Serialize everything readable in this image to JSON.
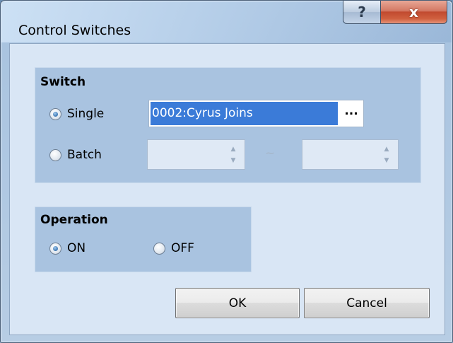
{
  "window": {
    "title": "Control Switches",
    "help_glyph": "?",
    "close_glyph": "x"
  },
  "switch_group": {
    "title": "Switch",
    "single_label": "Single",
    "batch_label": "Batch",
    "single_value": "0002:Cyrus Joins",
    "browse_label": "...",
    "range_separator": "~",
    "batch_from": "",
    "batch_to": "",
    "selected": "Single"
  },
  "operation_group": {
    "title": "Operation",
    "on_label": "ON",
    "off_label": "OFF",
    "selected": "ON"
  },
  "buttons": {
    "ok_label": "OK",
    "cancel_label": "Cancel"
  }
}
